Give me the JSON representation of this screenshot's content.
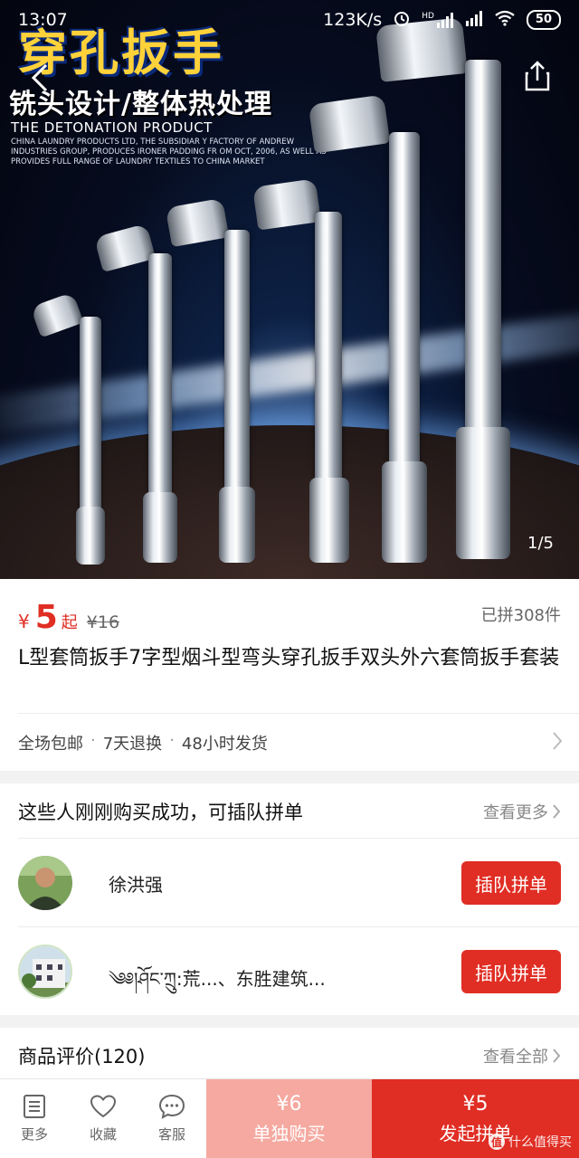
{
  "status_bar": {
    "time": "13:07",
    "net_speed": "123K/s",
    "hd_label": "HD",
    "battery": "50"
  },
  "hero": {
    "promo_title": "穿孔扳手",
    "promo_subtitle": "铣头设计/整体热处理",
    "promo_en_title": "THE DETONATION PRODUCT",
    "promo_en_small": "CHINA LAUNDRY PRODUCTS LTD, THE SUBSIDIAR Y FACTORY OF ANDREW INDUSTRIES GROUP, PRODUCES IRONER PADDING FR OM OCT, 2006, AS WELL AS PROVIDES FULL RANGE OF LAUNDRY TEXTILES TO CHINA MARKET",
    "pager": "1/5"
  },
  "product": {
    "currency": "¥",
    "price": "5",
    "price_suffix": "起",
    "original_price": "¥16",
    "sold": "已拼308件",
    "title": "L型套筒扳手7字型烟斗型弯头穿孔扳手双头外六套筒扳手套装",
    "services": [
      "全场包邮",
      "7天退换",
      "48小时发货"
    ],
    "service_sep": "·"
  },
  "group_buy": {
    "heading": "这些人刚刚购买成功，可插队拼单",
    "more_label": "查看更多",
    "join_label": "插队拼单",
    "rows": [
      {
        "name": "徐洪强"
      },
      {
        "name": "༄༅།ཤོང་ཀྲུ:荒...、东胜建筑..."
      }
    ]
  },
  "reviews": {
    "label": "商品评价(120)",
    "all_label": "查看全部"
  },
  "bottom_bar": {
    "nav": [
      {
        "label": "更多"
      },
      {
        "label": "收藏"
      },
      {
        "label": "客服"
      }
    ],
    "buy_alone_price": "¥6",
    "buy_alone_label": "单独购买",
    "buy_group_price": "¥5",
    "buy_group_label": "发起拼单",
    "watermark": "什么值得买"
  }
}
